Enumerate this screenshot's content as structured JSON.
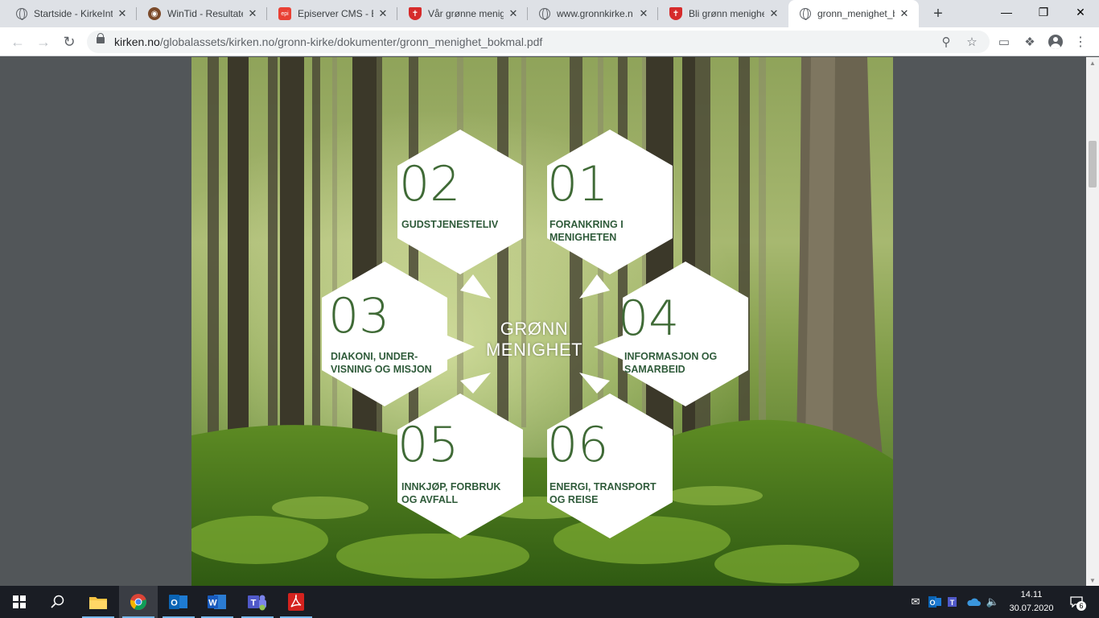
{
  "browser": {
    "tabs": [
      {
        "title": "Startside - KirkeInt",
        "icon": "globe-icon"
      },
      {
        "title": "WinTid - Resultate",
        "icon": "owl-icon"
      },
      {
        "title": "Episerver CMS - Ec",
        "icon": "episerver-icon"
      },
      {
        "title": "Vår grønne menigh",
        "icon": "church-shield-icon"
      },
      {
        "title": "www.gronnkirke.n",
        "icon": "globe-icon"
      },
      {
        "title": "Bli grønn menighe",
        "icon": "church-shield-icon"
      },
      {
        "title": "gronn_menighet_b",
        "icon": "globe-icon"
      }
    ],
    "active_tab_index": 6,
    "url_domain": "kirken.no",
    "url_path": "/globalassets/kirken.no/gronn-kirke/dokumenter/gronn_menighet_bokmal.pdf"
  },
  "pdf": {
    "center_title_line1": "GRØNN",
    "center_title_line2": "MENIGHET",
    "hexagons": [
      {
        "number": "01",
        "line1": "FORANKRING I",
        "line2": "MENIGHETEN"
      },
      {
        "number": "02",
        "line1": "GUDSTJENESTELIV",
        "line2": ""
      },
      {
        "number": "03",
        "line1": "DIAKONI, UNDER-",
        "line2": "VISNING OG MISJON"
      },
      {
        "number": "04",
        "line1": "INFORMASJON OG",
        "line2": "SAMARBEID"
      },
      {
        "number": "05",
        "line1": "INNKJØP, FORBRUK",
        "line2": "OG AVFALL"
      },
      {
        "number": "06",
        "line1": "ENERGI, TRANSPORT",
        "line2": "OG REISE"
      }
    ],
    "colors": {
      "text_green": "#2f5b3a",
      "number_green": "#3f6a36"
    }
  },
  "taskbar": {
    "time": "14.11",
    "date": "30.07.2020",
    "notification_count": "6",
    "apps": [
      "file-explorer",
      "chrome",
      "outlook",
      "word",
      "teams",
      "acrobat"
    ]
  }
}
